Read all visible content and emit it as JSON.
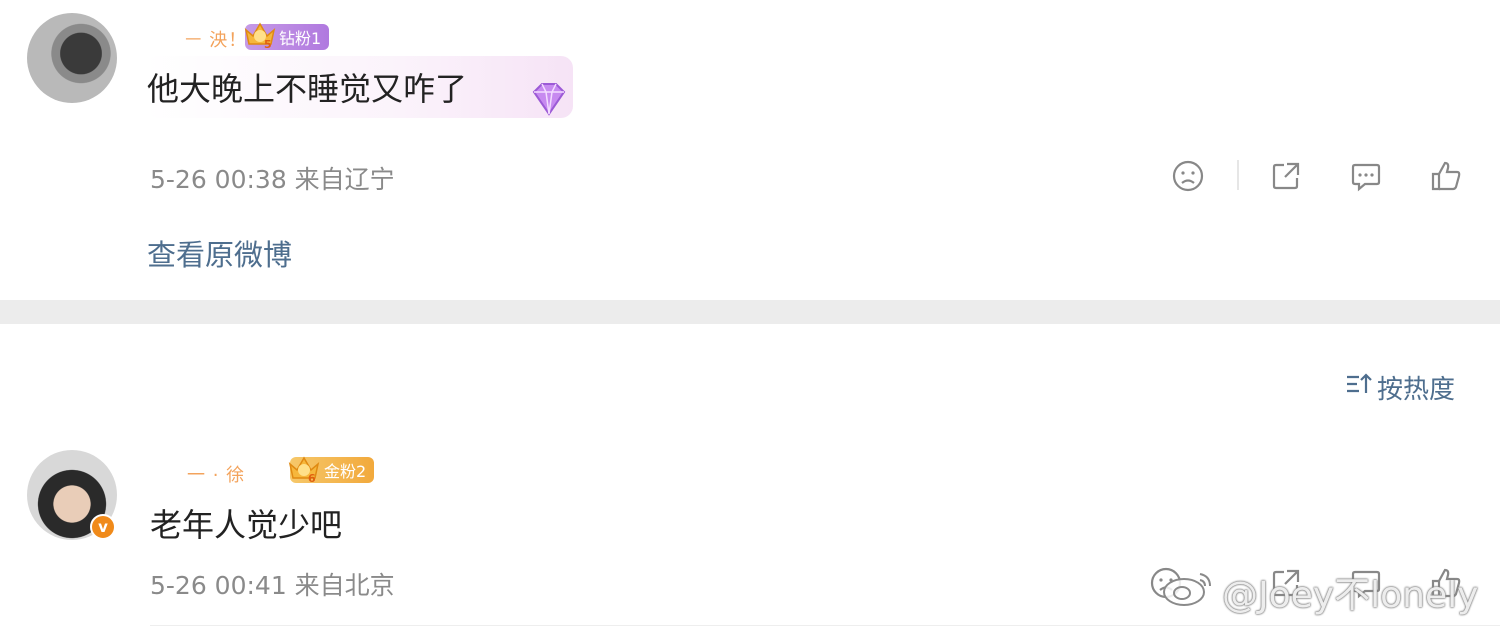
{
  "comments_top": {
    "username": "ㅡ 泱！",
    "fan_level": "5",
    "fan_badge": "钻粉1",
    "text": "他大晚上不睡觉又咋了",
    "meta": "5-26 00:38 来自辽宁",
    "view_original": "查看原微博"
  },
  "sort": {
    "label": "按热度"
  },
  "comments_bottom": {
    "username": "一 · 徐",
    "fan_level": "6",
    "fan_badge": "金粉2",
    "text": "老年人觉少吧",
    "meta": "5-26 00:41 来自北京",
    "verified": "v"
  },
  "watermark": "@Joey不lonely",
  "icons": {
    "dislike": "dislike-face-icon",
    "share": "share-icon",
    "comment": "comment-icon",
    "like": "like-icon",
    "sort": "sort-icon",
    "crown": "crown-icon",
    "diamond": "diamond-icon"
  },
  "colors": {
    "link": "#4e6e8e",
    "meta": "#8a8a8a",
    "diamond_fan": "#b079df",
    "gold_fan": "#f2a93c"
  }
}
